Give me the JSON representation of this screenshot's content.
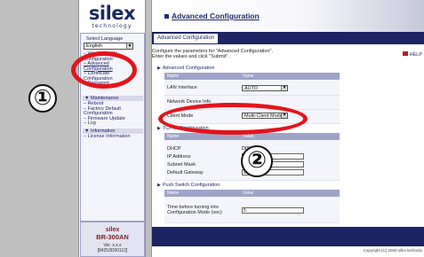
{
  "left_frame": {
    "logo": {
      "brand": "silex",
      "sub": "technology"
    },
    "language": {
      "label": "Select Language",
      "value": "English"
    },
    "menu_top": [
      {
        "label": "– Wireless LAN",
        "u": false
      },
      {
        "label": "  Configuration",
        "u": false
      },
      {
        "label": "– Advanced",
        "u": true
      },
      {
        "label": "  Configuration",
        "u": true
      },
      {
        "label": "– Certificate",
        "u": false
      },
      {
        "label": "  Configuration",
        "u": false
      },
      {
        "label": "– Password",
        "u": false
      }
    ],
    "maintenance": {
      "title": "▼ Maintenance",
      "items": [
        "– Reboot",
        "– Factory Default",
        "  Configuration",
        "– Firmware Update",
        "– Log"
      ]
    },
    "information": {
      "title": "▼ Information",
      "items": [
        "– License Information"
      ]
    },
    "model": {
      "brand": "silex",
      "name": "BR-300AN",
      "version": "Ver. x.x.x",
      "mac": "[84253D00112]"
    }
  },
  "content": {
    "title": "Advanced Configuration",
    "tab": "Advanced Configuration",
    "instruction_line1": "Configure the parameters for \"Advanced Configuration\".",
    "instruction_line2": "Enter the values and click \"Submit\".",
    "help": "HELP",
    "sections": {
      "advanced": "Advanced Configuration",
      "tcpip": "TCP/IP Configuration",
      "push": "Push Switch Configuration"
    },
    "table_headers": {
      "name": "Name",
      "value": "Value"
    },
    "rows_advanced": {
      "lan_interface": {
        "label": "LAN Interface",
        "value": "AUTO"
      },
      "network_device": {
        "label": "Network Device Info"
      },
      "client_mode": {
        "label": "Client Mode",
        "value": "Multi-Client Mode"
      }
    },
    "rows_tcpip": {
      "dhcp": {
        "label": "DHCP",
        "value": "DISA"
      },
      "ip": {
        "label": "IP Address",
        "value": "0.0"
      },
      "subnet": {
        "label": "Subnet Mask",
        "value": "0.0"
      },
      "gateway": {
        "label": "Default Gateway",
        "value": "0.0.0"
      }
    },
    "rows_push": {
      "time": {
        "label1": "Time before turning into",
        "label2": "Configuration Mode (sec)",
        "value": "5"
      }
    },
    "copyright": "Copyright (C) 2000 silex technolo"
  },
  "annotations": {
    "one": "①",
    "two": "②"
  },
  "colors": {
    "navy": "#1c2463",
    "annotation_red": "#e3141c"
  }
}
